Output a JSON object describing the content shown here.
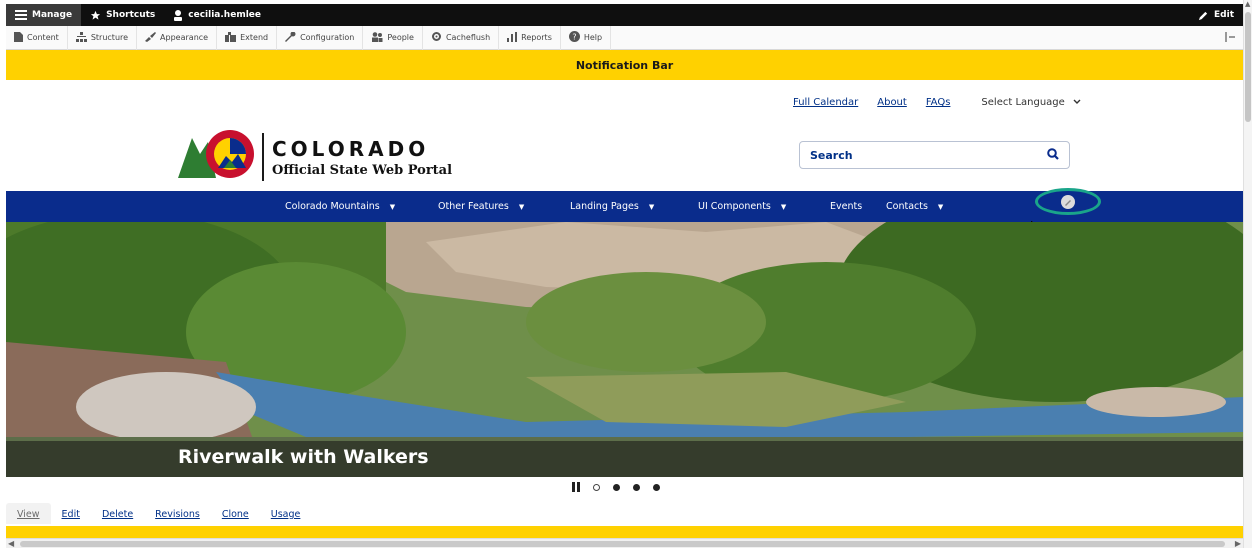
{
  "admin_bar": {
    "manage": "Manage",
    "shortcuts": "Shortcuts",
    "user": "cecilia.hemlee",
    "edit": "Edit"
  },
  "admin_tray": {
    "items": [
      "Content",
      "Structure",
      "Appearance",
      "Extend",
      "Configuration",
      "People",
      "Cacheflush",
      "Reports",
      "Help"
    ]
  },
  "notification": "Notification Bar",
  "utility": {
    "full_calendar": "Full Calendar",
    "about": "About",
    "faqs": "FAQs",
    "language": "Select Language"
  },
  "logo": {
    "title": "COLORADO",
    "subtitle": "Official State Web Portal"
  },
  "search": {
    "label": "Search"
  },
  "nav": {
    "items": [
      "Colorado Mountains",
      "Other Features",
      "Landing Pages",
      "UI Components",
      "Events",
      "Contacts"
    ]
  },
  "hero": {
    "caption": "Riverwalk with Walkers",
    "slides_total": 4,
    "active_slide": 1
  },
  "tasks": {
    "tabs": [
      "View",
      "Edit",
      "Delete",
      "Revisions",
      "Clone",
      "Usage"
    ]
  },
  "colors": {
    "notification_bg": "#ffd100",
    "nav_bg": "#0a2c8c",
    "link": "#003087",
    "toggle_ring": "#1aa58a"
  }
}
